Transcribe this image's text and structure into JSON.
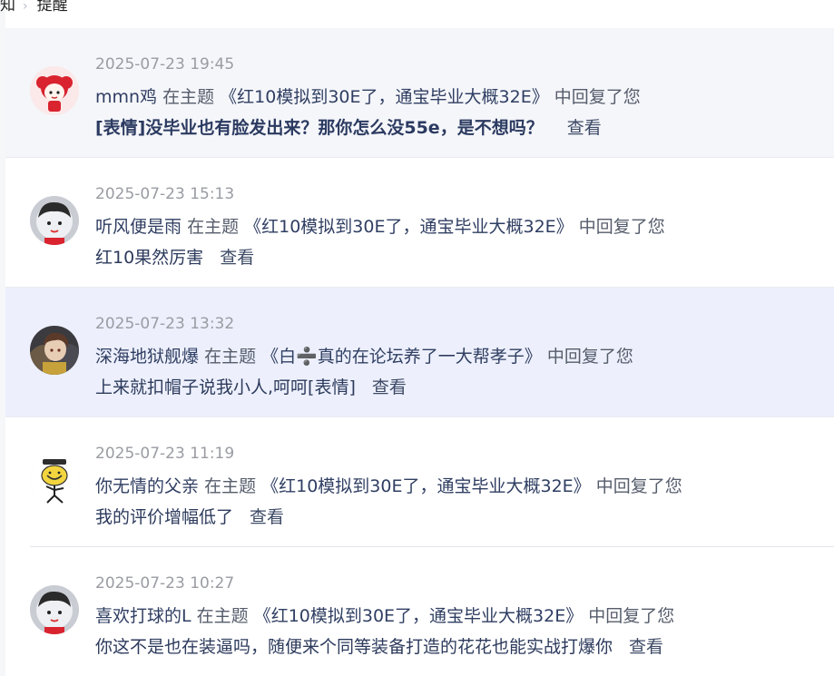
{
  "breadcrumb": {
    "parent": "知",
    "current": "提醒"
  },
  "notifications": [
    {
      "date": "2025-07-23 19:45",
      "user": "mmn鸡",
      "prefix": "在主题",
      "topic": "《红10模拟到30E了，通宝毕业大概32E》",
      "suffix": "中回复了您",
      "content": "[表情]没毕业也有脸发出来？那你怎么没55e，是不想吗？",
      "view": "查看"
    },
    {
      "date": "2025-07-23 15:13",
      "user": "听风便是雨",
      "prefix": "在主题",
      "topic": "《红10模拟到30E了，通宝毕业大概32E》",
      "suffix": "中回复了您",
      "content": "红10果然厉害",
      "view": "查看"
    },
    {
      "date": "2025-07-23 13:32",
      "user": "深海地狱舰爆",
      "prefix": "在主题",
      "topic": "《白➗真的在论坛养了一大帮孝子》",
      "suffix": "中回复了您",
      "content": "上来就扣帽子说我小人,呵呵[表情]",
      "view": "查看"
    },
    {
      "date": "2025-07-23 11:19",
      "user": "你无情的父亲",
      "prefix": "在主题",
      "topic": "《红10模拟到30E了，通宝毕业大概32E》",
      "suffix": "中回复了您",
      "content": "我的评价增幅低了",
      "view": "查看"
    },
    {
      "date": "2025-07-23 10:27",
      "user": "喜欢打球的L",
      "prefix": "在主题",
      "topic": "《红10模拟到30E了，通宝毕业大概32E》",
      "suffix": "中回复了您",
      "content": "你这不是也在装逼吗，随便来个同等装备打造的花花也能实战打爆你",
      "view": "查看"
    }
  ]
}
